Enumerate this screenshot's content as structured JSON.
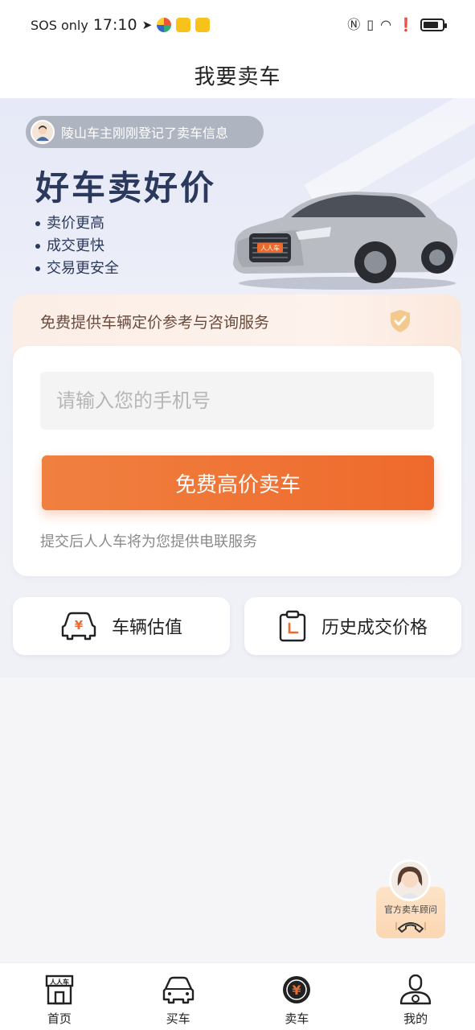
{
  "status_bar": {
    "carrier": "SOS only",
    "time": "17:10"
  },
  "page": {
    "title": "我要卖车"
  },
  "hero": {
    "notice": "陵山车主刚刚登记了卖车信息",
    "slogan": "好车卖好价",
    "bullets": [
      "卖价更高",
      "成交更快",
      "交易更安全"
    ],
    "car_plate": "人人车"
  },
  "form": {
    "header_text": "免费提供车辆定价参考与咨询服务",
    "phone_placeholder": "请输入您的手机号",
    "submit_label": "免费高价卖车",
    "hint": "提交后人人车将为您提供电联服务"
  },
  "quick_actions": [
    {
      "label": "车辆估值",
      "icon": "car-yuan-icon"
    },
    {
      "label": "历史成交价格",
      "icon": "clipboard-icon"
    }
  ],
  "advisor": {
    "label": "官方卖车顾问"
  },
  "bottom_nav": [
    {
      "label": "首页",
      "icon": "storefront-icon"
    },
    {
      "label": "买车",
      "icon": "car-icon"
    },
    {
      "label": "卖车",
      "icon": "yuan-coin-icon",
      "active": true
    },
    {
      "label": "我的",
      "icon": "user-icon"
    }
  ],
  "colors": {
    "accent": "#ee6a2c",
    "navy": "#2b3a5c"
  }
}
